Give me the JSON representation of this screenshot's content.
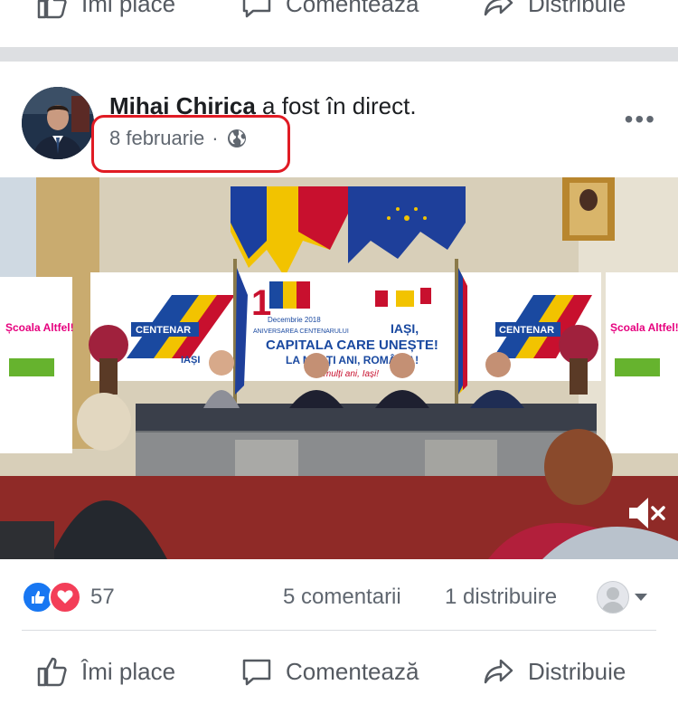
{
  "top_actions": {
    "like_label": "Îmi place",
    "comment_label": "Comentează",
    "share_label": "Distribuie"
  },
  "post": {
    "author": "Mihai Chirica",
    "action_text": " a fost în direct.",
    "date": "8 februarie",
    "dot": "·",
    "privacy_icon": "globe-icon",
    "more_label": "•••",
    "highlight_color": "#e01b24"
  },
  "video": {
    "banner_number": "1",
    "banner_date": "Decembrie 2018",
    "banner_org": "ANIVERSAREA CENTENARULUI",
    "banner_city": "IAȘI,",
    "banner_tagline": "CAPITALA CARE UNEȘTE!",
    "banner_line2": "LA MULȚI ANI, ROMÂNIA!",
    "banner_line3": "La mulți ani, Iași!",
    "centenar_label": "CENTENAR",
    "centenar_city": "IAȘI",
    "side_banner_title": "Școala Altfel!",
    "mute_icon": "speaker-muted-icon"
  },
  "stats": {
    "reaction_count": "57",
    "comments": "5 comentarii",
    "shares": "1 distribuire"
  },
  "bottom_actions": {
    "like_label": "Îmi place",
    "comment_label": "Comentează",
    "share_label": "Distribuie"
  },
  "colors": {
    "like_blue": "#1877f2",
    "love_red": "#f33e58",
    "muted_text": "#606770",
    "action_text": "#555a61",
    "divider": "#dddfe2"
  }
}
